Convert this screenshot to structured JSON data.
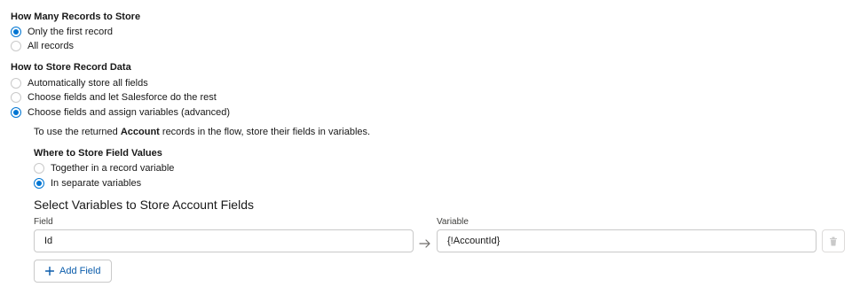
{
  "records_to_store": {
    "label": "How Many Records to Store",
    "options": [
      {
        "label": "Only the first record",
        "selected": true
      },
      {
        "label": "All records",
        "selected": false
      }
    ]
  },
  "record_data": {
    "label": "How to Store Record Data",
    "options": [
      {
        "label": "Automatically store all fields",
        "selected": false
      },
      {
        "label": "Choose fields and let Salesforce do the rest",
        "selected": false
      },
      {
        "label": "Choose fields and assign variables (advanced)",
        "selected": true
      }
    ]
  },
  "info": {
    "prefix": "To use the returned ",
    "object": "Account",
    "suffix": " records in the flow, store their fields in variables."
  },
  "field_values": {
    "label": "Where to Store Field Values",
    "options": [
      {
        "label": "Together in a record variable",
        "selected": false
      },
      {
        "label": "In separate variables",
        "selected": true
      }
    ]
  },
  "mapping": {
    "heading": "Select Variables to Store Account Fields",
    "field_label": "Field",
    "variable_label": "Variable",
    "rows": [
      {
        "field": "Id",
        "variable": "{!AccountId}"
      }
    ],
    "add_label": "Add Field"
  },
  "colors": {
    "accent": "#0176d3",
    "link": "#0b5cab",
    "border": "#c9c9c9"
  },
  "icons": {
    "arrow": "arrow-right-icon",
    "delete": "delete-icon",
    "add": "add-icon"
  }
}
